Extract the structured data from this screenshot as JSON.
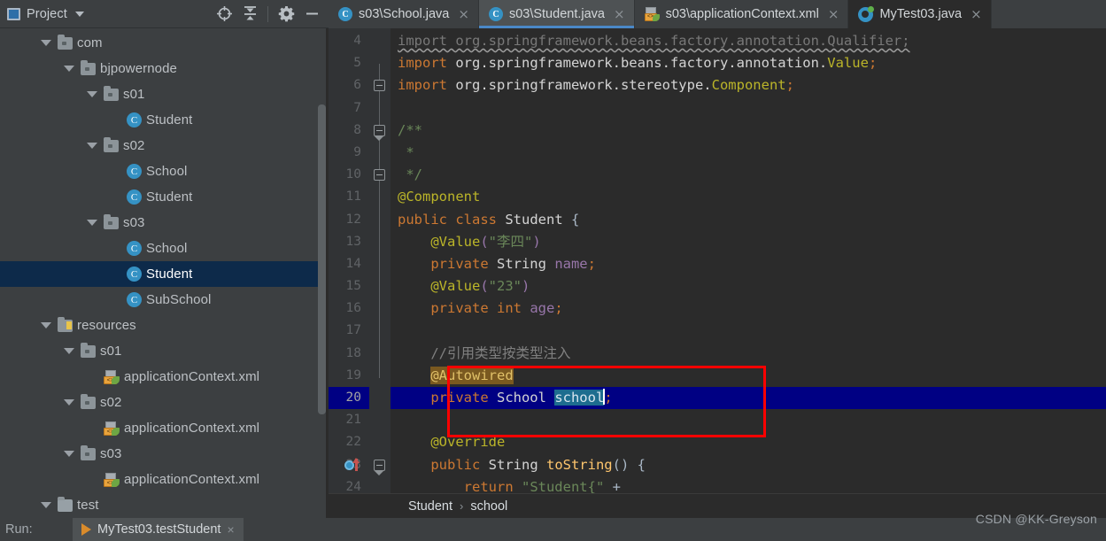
{
  "project_panel": {
    "title": "Project",
    "icons": [
      {
        "name": "locate-icon",
        "glyph": "target"
      },
      {
        "name": "collapse-all-icon",
        "glyph": "collapse"
      },
      {
        "name": "settings-gear-icon",
        "glyph": "gear"
      },
      {
        "name": "hide-panel-icon",
        "glyph": "minus"
      }
    ],
    "tree": [
      {
        "label": "com",
        "indent": 1,
        "icon": "folder",
        "arrow": "expanded",
        "selected": false
      },
      {
        "label": "bjpowernode",
        "indent": 2,
        "icon": "folder",
        "arrow": "expanded",
        "selected": false
      },
      {
        "label": "s01",
        "indent": 3,
        "icon": "folder",
        "arrow": "expanded",
        "selected": false
      },
      {
        "label": "Student",
        "indent": 4,
        "icon": "class",
        "arrow": "none",
        "selected": false
      },
      {
        "label": "s02",
        "indent": 3,
        "icon": "folder",
        "arrow": "expanded",
        "selected": false
      },
      {
        "label": "School",
        "indent": 4,
        "icon": "class",
        "arrow": "none",
        "selected": false
      },
      {
        "label": "Student",
        "indent": 4,
        "icon": "class",
        "arrow": "none",
        "selected": false
      },
      {
        "label": "s03",
        "indent": 3,
        "icon": "folder",
        "arrow": "expanded",
        "selected": false
      },
      {
        "label": "School",
        "indent": 4,
        "icon": "class",
        "arrow": "none",
        "selected": false
      },
      {
        "label": "Student",
        "indent": 4,
        "icon": "class",
        "arrow": "none",
        "selected": true
      },
      {
        "label": "SubSchool",
        "indent": 4,
        "icon": "class",
        "arrow": "none",
        "selected": false
      },
      {
        "label": "resources",
        "indent": 1,
        "icon": "resources",
        "arrow": "expanded",
        "selected": false
      },
      {
        "label": "s01",
        "indent": 2,
        "icon": "folder",
        "arrow": "expanded",
        "selected": false
      },
      {
        "label": "applicationContext.xml",
        "indent": 3,
        "icon": "xml",
        "arrow": "none",
        "selected": false
      },
      {
        "label": "s02",
        "indent": 2,
        "icon": "folder",
        "arrow": "expanded",
        "selected": false
      },
      {
        "label": "applicationContext.xml",
        "indent": 3,
        "icon": "xml",
        "arrow": "none",
        "selected": false
      },
      {
        "label": "s03",
        "indent": 2,
        "icon": "folder",
        "arrow": "expanded",
        "selected": false
      },
      {
        "label": "applicationContext.xml",
        "indent": 3,
        "icon": "xml",
        "arrow": "none",
        "selected": false
      },
      {
        "label": "test",
        "indent": 1,
        "icon": "plain",
        "arrow": "expanded",
        "selected": false
      }
    ]
  },
  "editor_tabs": [
    {
      "label": "s03\\School.java",
      "icon": "java-class-icon",
      "state": "inactive",
      "close": "×"
    },
    {
      "label": "s03\\Student.java",
      "icon": "java-class-icon",
      "state": "active",
      "close": "×"
    },
    {
      "label": "s03\\applicationContext.xml",
      "icon": "spring-xml-icon",
      "state": "inactive",
      "close": "×"
    },
    {
      "label": "MyTest03.java",
      "icon": "java-test-icon",
      "state": "dark",
      "close": "×"
    }
  ],
  "editor": {
    "first_line_number": 4,
    "caret_line": 20,
    "lines": [
      {
        "n": 4,
        "fold": "none",
        "tokens": [
          {
            "t": "import org.springframework.beans.factory.annotation.Qualifier;",
            "c": "unused"
          }
        ]
      },
      {
        "n": 5,
        "fold": "none",
        "tokens": [
          {
            "t": "import ",
            "c": "kw"
          },
          {
            "t": "org.springframework.beans.factory.annotation.",
            "c": "white"
          },
          {
            "t": "Value",
            "c": "anno"
          },
          {
            "t": ";",
            "c": "pun"
          }
        ]
      },
      {
        "n": 6,
        "fold": "close",
        "tokens": [
          {
            "t": "import ",
            "c": "kw"
          },
          {
            "t": "org.springframework.stereotype.",
            "c": "white"
          },
          {
            "t": "Component",
            "c": "anno"
          },
          {
            "t": ";",
            "c": "pun"
          }
        ]
      },
      {
        "n": 7,
        "fold": "none",
        "tokens": []
      },
      {
        "n": 8,
        "fold": "open",
        "tokens": [
          {
            "t": "/**",
            "c": "str"
          }
        ]
      },
      {
        "n": 9,
        "fold": "none",
        "tokens": [
          {
            "t": " *",
            "c": "str"
          }
        ]
      },
      {
        "n": 10,
        "fold": "close",
        "tokens": [
          {
            "t": " */",
            "c": "str"
          }
        ]
      },
      {
        "n": 11,
        "fold": "none",
        "tokens": [
          {
            "t": "@Component",
            "c": "anno"
          }
        ]
      },
      {
        "n": 12,
        "fold": "none",
        "tokens": [
          {
            "t": "public ",
            "c": "kw"
          },
          {
            "t": "class ",
            "c": "kw"
          },
          {
            "t": "Student ",
            "c": "white"
          },
          {
            "t": "{",
            "c": "cls"
          }
        ]
      },
      {
        "n": 13,
        "fold": "none",
        "tokens": [
          {
            "t": "    ",
            "c": "cls"
          },
          {
            "t": "@Value",
            "c": "anno"
          },
          {
            "t": "(",
            "c": "fld"
          },
          {
            "t": "\"李四\"",
            "c": "str"
          },
          {
            "t": ")",
            "c": "fld"
          }
        ]
      },
      {
        "n": 14,
        "fold": "none",
        "tokens": [
          {
            "t": "    ",
            "c": "cls"
          },
          {
            "t": "private ",
            "c": "kw"
          },
          {
            "t": "String ",
            "c": "white"
          },
          {
            "t": "name",
            "c": "fld"
          },
          {
            "t": ";",
            "c": "pun"
          }
        ]
      },
      {
        "n": 15,
        "fold": "none",
        "tokens": [
          {
            "t": "    ",
            "c": "cls"
          },
          {
            "t": "@Value",
            "c": "anno"
          },
          {
            "t": "(",
            "c": "fld"
          },
          {
            "t": "\"23\"",
            "c": "str"
          },
          {
            "t": ")",
            "c": "fld"
          }
        ]
      },
      {
        "n": 16,
        "fold": "none",
        "tokens": [
          {
            "t": "    ",
            "c": "cls"
          },
          {
            "t": "private ",
            "c": "kw"
          },
          {
            "t": "int ",
            "c": "kw"
          },
          {
            "t": "age",
            "c": "fld"
          },
          {
            "t": ";",
            "c": "pun"
          }
        ]
      },
      {
        "n": 17,
        "fold": "none",
        "tokens": []
      },
      {
        "n": 18,
        "fold": "none",
        "tokens": [
          {
            "t": "    ",
            "c": "cls"
          },
          {
            "t": "//引用类型按类型注入",
            "c": "cmt"
          }
        ]
      },
      {
        "n": 19,
        "fold": "none",
        "tokens": [
          {
            "t": "    ",
            "c": "cls"
          },
          {
            "t": "@Autowired",
            "c": "hl-anno"
          }
        ]
      },
      {
        "n": 20,
        "fold": "none",
        "tokens": [
          {
            "t": "    ",
            "c": "cls"
          },
          {
            "t": "private ",
            "c": "kw"
          },
          {
            "t": "School ",
            "c": "white"
          },
          {
            "t": "school",
            "c": "sel-word"
          },
          {
            "t": "│",
            "c": "caret"
          },
          {
            "t": ";",
            "c": "pun"
          }
        ]
      },
      {
        "n": 21,
        "fold": "none",
        "tokens": []
      },
      {
        "n": 22,
        "fold": "none",
        "tokens": [
          {
            "t": "    ",
            "c": "cls"
          },
          {
            "t": "@Override",
            "c": "anno"
          }
        ]
      },
      {
        "n": 23,
        "fold": "open",
        "tokens": [
          {
            "t": "    ",
            "c": "cls"
          },
          {
            "t": "public ",
            "c": "kw"
          },
          {
            "t": "String ",
            "c": "white"
          },
          {
            "t": "toString",
            "c": "mth"
          },
          {
            "t": "() {",
            "c": "cls"
          }
        ],
        "gutter_icon": "override-method-icon"
      },
      {
        "n": 24,
        "fold": "none",
        "tokens": [
          {
            "t": "        ",
            "c": "cls"
          },
          {
            "t": "return ",
            "c": "kw"
          },
          {
            "t": "\"Student{\"",
            "c": "str"
          },
          {
            "t": " +",
            "c": "cls"
          }
        ]
      }
    ],
    "highlight_box": {
      "color": "#fe0000",
      "around_lines": "18-20"
    }
  },
  "breadcrumb": {
    "items": [
      "Student",
      "school"
    ],
    "separator": "›"
  },
  "bottom_bar": {
    "run_label": "Run:",
    "run_tab": "MyTest03.testStudent",
    "run_tab_close": "×"
  },
  "watermark": "CSDN @KK-Greyson"
}
